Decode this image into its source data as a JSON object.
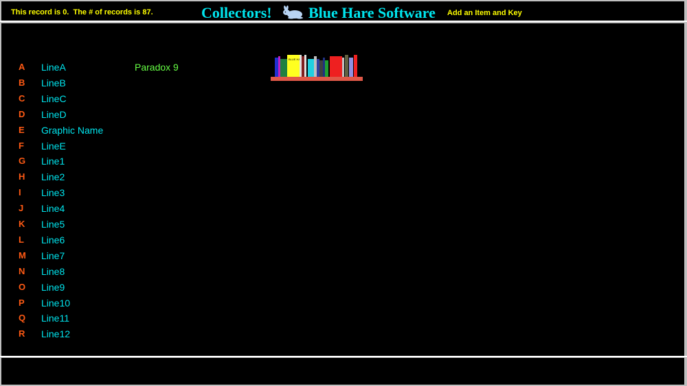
{
  "header": {
    "record_info": "This record is 0.  The # of records is 87.",
    "title_left": "Collectors!",
    "logo_icon": "hare-icon",
    "title_right": "Blue Hare Software",
    "add_link": "Add an Item and Key"
  },
  "banner": {
    "icon": "bookshelf-icon",
    "book_label": "BLUE HARE"
  },
  "fields": [
    {
      "key": "A",
      "label": "LineA",
      "value": "Paradox 9"
    },
    {
      "key": "B",
      "label": "LineB",
      "value": ""
    },
    {
      "key": "C",
      "label": "LineC",
      "value": ""
    },
    {
      "key": "D",
      "label": "LineD",
      "value": ""
    },
    {
      "key": "E",
      "label": "Graphic Name",
      "value": ""
    },
    {
      "key": "F",
      "label": "LineE",
      "value": ""
    },
    {
      "key": "G",
      "label": "Line1",
      "value": ""
    },
    {
      "key": "H",
      "label": "Line2",
      "value": ""
    },
    {
      "key": "I",
      "label": "Line3",
      "value": ""
    },
    {
      "key": "J",
      "label": "Line4",
      "value": ""
    },
    {
      "key": "K",
      "label": "Line5",
      "value": ""
    },
    {
      "key": "L",
      "label": "Line6",
      "value": ""
    },
    {
      "key": "M",
      "label": "Line7",
      "value": ""
    },
    {
      "key": "N",
      "label": "Line8",
      "value": ""
    },
    {
      "key": "O",
      "label": "Line9",
      "value": ""
    },
    {
      "key": "P",
      "label": "Line10",
      "value": ""
    },
    {
      "key": "Q",
      "label": "Line11",
      "value": ""
    },
    {
      "key": "R",
      "label": "Line12",
      "value": ""
    }
  ],
  "colors": {
    "background": "#000000",
    "key": "#ff5a14",
    "label": "#00e5ee",
    "value": "#66ff44",
    "header_text": "#ffff00"
  }
}
